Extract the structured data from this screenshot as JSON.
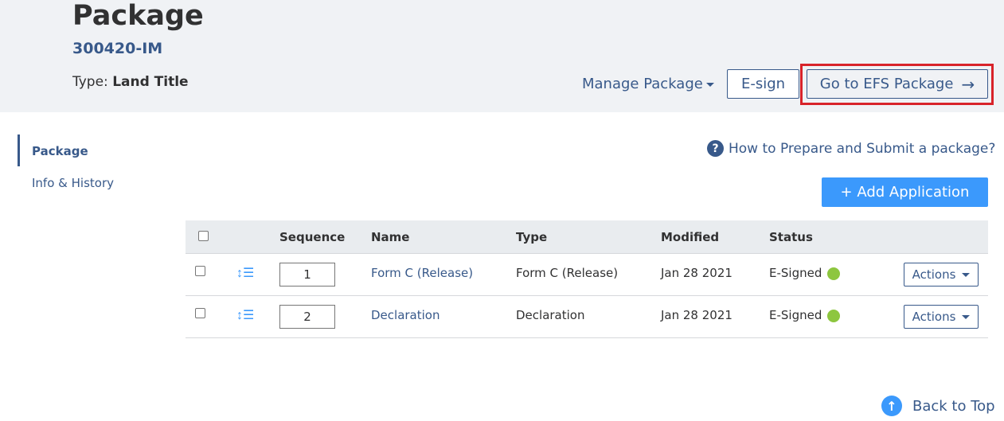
{
  "header": {
    "title": "Package",
    "package_number": "300420-IM",
    "type_label": "Type:",
    "type_value": "Land Title",
    "manage_label": "Manage Package",
    "esign_label": "E-sign",
    "efs_label": "Go to EFS Package"
  },
  "sidebar": {
    "items": [
      {
        "label": "Package"
      },
      {
        "label": "Info & History"
      }
    ]
  },
  "help": {
    "label": "How to Prepare and Submit a package?"
  },
  "add_application": {
    "label": "+ Add Application"
  },
  "table": {
    "columns": [
      "Sequence",
      "Name",
      "Type",
      "Modified",
      "Status"
    ],
    "rows": [
      {
        "sequence": "1",
        "name": "Form C (Release)",
        "type": "Form C (Release)",
        "modified": "Jan 28 2021",
        "status": "E-Signed",
        "actions": "Actions"
      },
      {
        "sequence": "2",
        "name": "Declaration",
        "type": "Declaration",
        "modified": "Jan 28 2021",
        "status": "E-Signed",
        "actions": "Actions"
      }
    ]
  },
  "footer": {
    "back_to_top": "Back to Top"
  },
  "colors": {
    "accent": "#38598a",
    "primary_button": "#3b99fc",
    "status_ok": "#8dc63f",
    "highlight": "#d8232a"
  }
}
